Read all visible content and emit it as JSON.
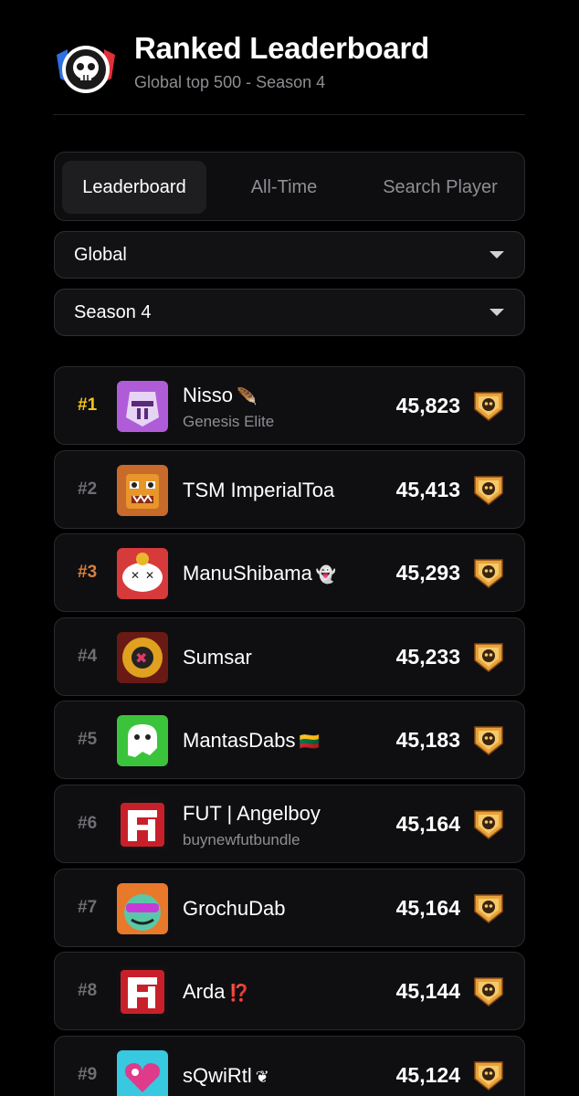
{
  "header": {
    "title": "Ranked Leaderboard",
    "subtitle": "Global top 500 - Season 4",
    "logo_icon": "skull-shield-logo"
  },
  "tabs": [
    {
      "label": "Leaderboard",
      "active": true
    },
    {
      "label": "All-Time",
      "active": false
    },
    {
      "label": "Search Player",
      "active": false
    }
  ],
  "filters": {
    "region": "Global",
    "season": "Season 4"
  },
  "players": [
    {
      "rank": "#1",
      "name": "Nisso",
      "suffix": "🪶",
      "club": "Genesis Elite",
      "score": "45,823",
      "avatar_icon": "knight-helmet-avatar",
      "avatar_color": "#b05cd8"
    },
    {
      "rank": "#2",
      "name": "TSM ImperialToa",
      "suffix": "",
      "club": "",
      "score": "45,413",
      "avatar_icon": "tiki-mask-avatar",
      "avatar_color": "#c86a2a"
    },
    {
      "rank": "#3",
      "name": "ManuShibama",
      "suffix": "👻",
      "club": "",
      "score": "45,293",
      "avatar_icon": "dizzy-skull-avatar",
      "avatar_color": "#d63a3a"
    },
    {
      "rank": "#4",
      "name": "Sumsar",
      "suffix": "",
      "club": "",
      "score": "45,233",
      "avatar_icon": "crossed-target-avatar",
      "avatar_color": "#e0a020"
    },
    {
      "rank": "#5",
      "name": "MantasDabs",
      "suffix": "🇱🇹",
      "club": "",
      "score": "45,183",
      "avatar_icon": "ghost-avatar",
      "avatar_color": "#3bc43b"
    },
    {
      "rank": "#6",
      "name": "FUT | Angelboy",
      "suffix": "",
      "club": "buynewfutbundle",
      "score": "45,164",
      "avatar_icon": "fut-logo-avatar",
      "avatar_color": "#c8202a"
    },
    {
      "rank": "#7",
      "name": "GrochuDab",
      "suffix": "",
      "club": "",
      "score": "45,164",
      "avatar_icon": "sunglasses-monster-avatar",
      "avatar_color": "#e8782a"
    },
    {
      "rank": "#8",
      "name": "Arda",
      "suffix": "⁉️",
      "club": "",
      "score": "45,144",
      "avatar_icon": "fut-logo-avatar",
      "avatar_color": "#c8202a"
    },
    {
      "rank": "#9",
      "name": "sQwiRtl",
      "suffix": "❦",
      "club": "",
      "score": "45,124",
      "avatar_icon": "heart-avatar",
      "avatar_color": "#38c8e0"
    }
  ],
  "colors": {
    "gold": "#f5c518",
    "bronze": "#d9803b",
    "muted": "#8e8e93",
    "card": "#0f0f11"
  },
  "rank_badge_icon": "masters-skull-badge-icon"
}
